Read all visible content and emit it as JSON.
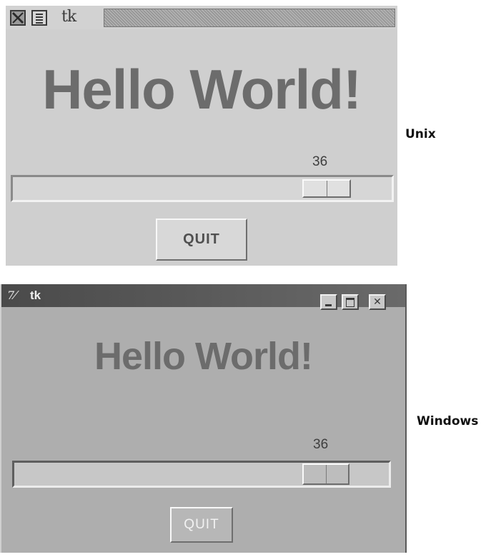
{
  "unix": {
    "caption": "Unix",
    "window_title": "tk",
    "greeting": "Hello World!",
    "scale": {
      "value": "36",
      "fraction": 0.78
    },
    "quit_label": "QUIT"
  },
  "windows": {
    "caption": "Windows",
    "window_title": "tk",
    "tk_icon_glyph": "7⁄",
    "greeting": "Hello World!",
    "scale": {
      "value": "36",
      "fraction": 0.78
    },
    "quit_label": "QUIT",
    "minimize_glyph": "",
    "close_glyph": "✕"
  },
  "colors": {
    "greeting_text": "#6c6c6c",
    "unix_bg": "#cfcfcf",
    "windows_bg": "#aeaeae"
  }
}
